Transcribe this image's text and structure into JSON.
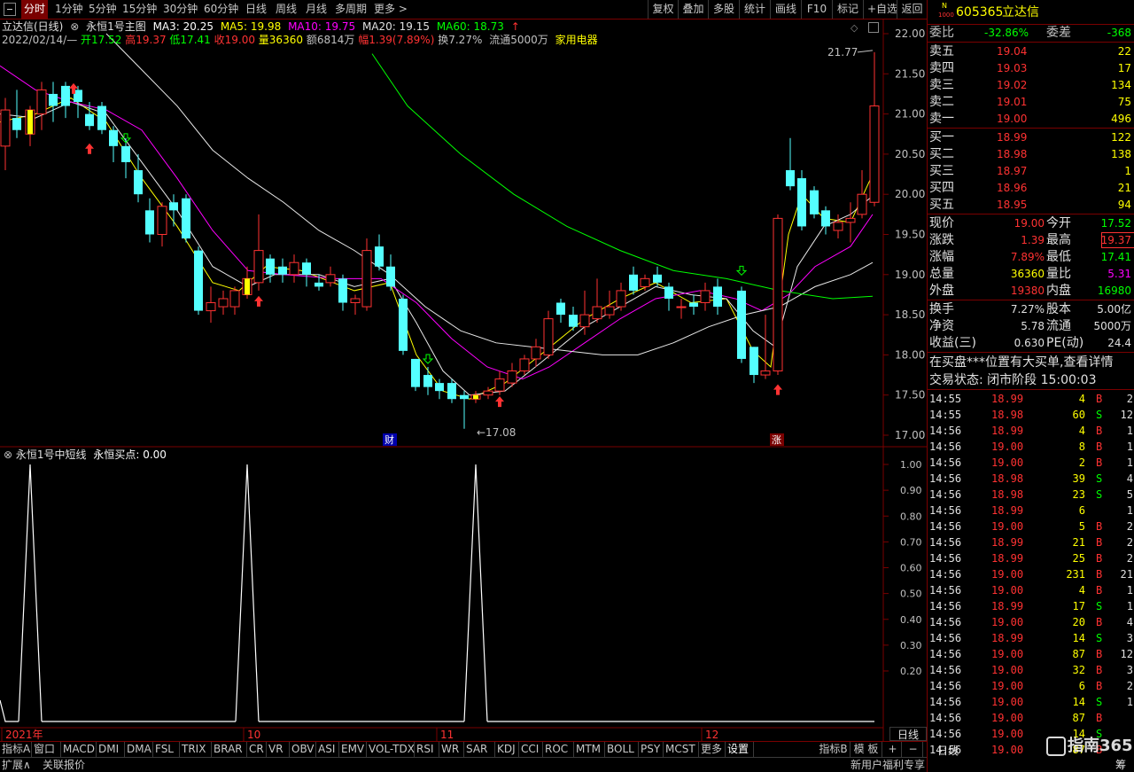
{
  "colors": {
    "up": "#ff3232",
    "down": "#54ffff",
    "ma3": "#ffff00",
    "ma5": "#e8e8e8",
    "ma10": "#ff00ff",
    "ma20": "#00ff00",
    "ma60": "#00ff00",
    "bg": "#000000",
    "grid": "#7a0000",
    "yellow": "#ffff00",
    "green": "#00ff00",
    "red": "#ff3232",
    "white": "#ffffff"
  },
  "topbar": {
    "timeframes": [
      {
        "label": "分时",
        "active": true
      },
      {
        "label": "1分钟"
      },
      {
        "label": "5分钟"
      },
      {
        "label": "15分钟"
      },
      {
        "label": "30分钟"
      },
      {
        "label": "60分钟"
      },
      {
        "label": "日线"
      },
      {
        "label": "周线"
      },
      {
        "label": "月线"
      },
      {
        "label": "多周期"
      },
      {
        "label": "更多 >"
      }
    ],
    "tools": [
      "复权",
      "叠加",
      "多股",
      "统计",
      "画线",
      "F10",
      "标记",
      "+自选",
      "返回"
    ]
  },
  "main_chart": {
    "title": "立达信(日线)",
    "indicator_name": "永恒1号主图",
    "ma": [
      {
        "label": "MA3: 20.25",
        "key": "ma3"
      },
      {
        "label": "MA5: 19.98",
        "key": "ma5"
      },
      {
        "label": "MA10: 19.75",
        "key": "ma10"
      },
      {
        "label": "MA20: 19.15",
        "key": "ma20"
      },
      {
        "label": "MA60: 18.73",
        "key": "ma60"
      }
    ],
    "quote": {
      "date": "2022/02/14/—",
      "open": "开17.52",
      "high": "高19.37",
      "low": "低17.41",
      "close": "收19.00",
      "volume": "量36360",
      "amount": "额6814万",
      "change": "幅1.39(7.89%)",
      "turnover": "换7.27%",
      "float": "流通5000万",
      "sector": "家用电器"
    },
    "y_ticks": [
      "22.00",
      "21.50",
      "21.00",
      "20.50",
      "20.00",
      "19.50",
      "19.00",
      "18.50",
      "18.00",
      "17.50",
      "17.00"
    ],
    "high_label": "21.77",
    "low_label": "17.08",
    "markers": {
      "cai": "财",
      "zhang": "涨"
    }
  },
  "sub_chart": {
    "title": "永恒1号中短线",
    "value": "永恒买点: 0.00",
    "y_ticks": [
      "1.00",
      "0.90",
      "0.80",
      "0.70",
      "0.60",
      "0.50",
      "0.40",
      "0.30",
      "0.20"
    ],
    "tail_label": "日线"
  },
  "x_axis": {
    "labels": [
      "2021年",
      "10",
      "11",
      "12"
    ]
  },
  "bottom_tabs": [
    "指标A",
    "窗口",
    "MACD",
    "DMI",
    "DMA",
    "FSL",
    "TRIX",
    "BRAR",
    "CR",
    "VR",
    "OBV",
    "ASI",
    "EMV",
    "VOL-TDX",
    "RSI",
    "WR",
    "SAR",
    "KDJ",
    "CCI",
    "ROC",
    "MTM",
    "BOLL",
    "PSY",
    "MCST",
    "更多",
    "设置"
  ],
  "bottom_right": {
    "zhibiao_b": "指标B",
    "moban": "模 板",
    "plus": "+",
    "minus": "−"
  },
  "status": {
    "expand": "扩展∧",
    "related": "关联报价",
    "promo": "新用户福利专享",
    "rilian": "日线"
  },
  "right_panel": {
    "code": "605365",
    "name": "立达信",
    "badge_n": "N",
    "badge_num": "1000",
    "weibi_label": "委比",
    "weibi": "-32.86%",
    "weicha_label": "委差",
    "weicha": "-368",
    "asks": [
      {
        "label": "卖五",
        "price": "19.04",
        "vol": "22"
      },
      {
        "label": "卖四",
        "price": "19.03",
        "vol": "17"
      },
      {
        "label": "卖三",
        "price": "19.02",
        "vol": "134"
      },
      {
        "label": "卖二",
        "price": "19.01",
        "vol": "75"
      },
      {
        "label": "卖一",
        "price": "19.00",
        "vol": "496"
      }
    ],
    "bids": [
      {
        "label": "买一",
        "price": "18.99",
        "vol": "122"
      },
      {
        "label": "买二",
        "price": "18.98",
        "vol": "138"
      },
      {
        "label": "买三",
        "price": "18.97",
        "vol": "1"
      },
      {
        "label": "买四",
        "price": "18.96",
        "vol": "21"
      },
      {
        "label": "买五",
        "price": "18.95",
        "vol": "94"
      }
    ],
    "stats": [
      {
        "l1": "现价",
        "v1": "19.00",
        "l2": "今开",
        "v2": "17.52"
      },
      {
        "l1": "涨跌",
        "v1": "1.39",
        "l2": "最高",
        "v2": "19.37"
      },
      {
        "l1": "涨幅",
        "v1": "7.89%",
        "l2": "最低",
        "v2": "17.41"
      },
      {
        "l1": "总量",
        "v1": "36360",
        "l2": "量比",
        "v2": "5.31"
      },
      {
        "l1": "外盘",
        "v1": "19380",
        "l2": "内盘",
        "v2": "16980"
      }
    ],
    "stats2": [
      {
        "l1": "换手",
        "v1": "7.27%",
        "l2": "股本",
        "v2": "5.00亿"
      },
      {
        "l1": "净资",
        "v1": "5.78",
        "l2": "流通",
        "v2": "5000万"
      },
      {
        "l1": "收益(三)",
        "v1": "0.630",
        "l2": "PE(动)",
        "v2": "24.4"
      }
    ],
    "message": "在买盘***位置有大买单,查看详情",
    "trade_status": "交易状态: 闭市阶段 15:00:03",
    "ticks": [
      {
        "t": "14:55",
        "p": "18.99",
        "v": "4",
        "d": "B",
        "n": "2"
      },
      {
        "t": "14:55",
        "p": "18.98",
        "v": "60",
        "d": "S",
        "n": "12"
      },
      {
        "t": "14:56",
        "p": "18.99",
        "v": "4",
        "d": "B",
        "n": "1"
      },
      {
        "t": "14:56",
        "p": "19.00",
        "v": "8",
        "d": "B",
        "n": "1"
      },
      {
        "t": "14:56",
        "p": "19.00",
        "v": "2",
        "d": "B",
        "n": "1"
      },
      {
        "t": "14:56",
        "p": "18.98",
        "v": "39",
        "d": "S",
        "n": "4"
      },
      {
        "t": "14:56",
        "p": "18.98",
        "v": "23",
        "d": "S",
        "n": "5"
      },
      {
        "t": "14:56",
        "p": "18.99",
        "v": "6",
        "d": "",
        "n": "1"
      },
      {
        "t": "14:56",
        "p": "19.00",
        "v": "5",
        "d": "B",
        "n": "2"
      },
      {
        "t": "14:56",
        "p": "18.99",
        "v": "21",
        "d": "B",
        "n": "2"
      },
      {
        "t": "14:56",
        "p": "18.99",
        "v": "25",
        "d": "B",
        "n": "2"
      },
      {
        "t": "14:56",
        "p": "19.00",
        "v": "231",
        "d": "B",
        "n": "21"
      },
      {
        "t": "14:56",
        "p": "19.00",
        "v": "4",
        "d": "B",
        "n": "1"
      },
      {
        "t": "14:56",
        "p": "18.99",
        "v": "17",
        "d": "S",
        "n": "1"
      },
      {
        "t": "14:56",
        "p": "19.00",
        "v": "20",
        "d": "B",
        "n": "4"
      },
      {
        "t": "14:56",
        "p": "18.99",
        "v": "14",
        "d": "S",
        "n": "3"
      },
      {
        "t": "14:56",
        "p": "19.00",
        "v": "87",
        "d": "B",
        "n": "12"
      },
      {
        "t": "14:56",
        "p": "19.00",
        "v": "32",
        "d": "B",
        "n": "3"
      },
      {
        "t": "14:56",
        "p": "19.00",
        "v": "6",
        "d": "B",
        "n": "2"
      },
      {
        "t": "14:56",
        "p": "19.00",
        "v": "14",
        "d": "S",
        "n": "1"
      },
      {
        "t": "14:56",
        "p": "19.00",
        "v": "87",
        "d": "B",
        "n": ""
      },
      {
        "t": "14:56",
        "p": "19.00",
        "v": "14",
        "d": "S",
        "n": ""
      },
      {
        "t": "14:56",
        "p": "19.00",
        "v": "87",
        "d": "B",
        "n": ""
      }
    ],
    "watermark": "指南365",
    "tail_label": "日线",
    "tail_char": "筹"
  }
}
